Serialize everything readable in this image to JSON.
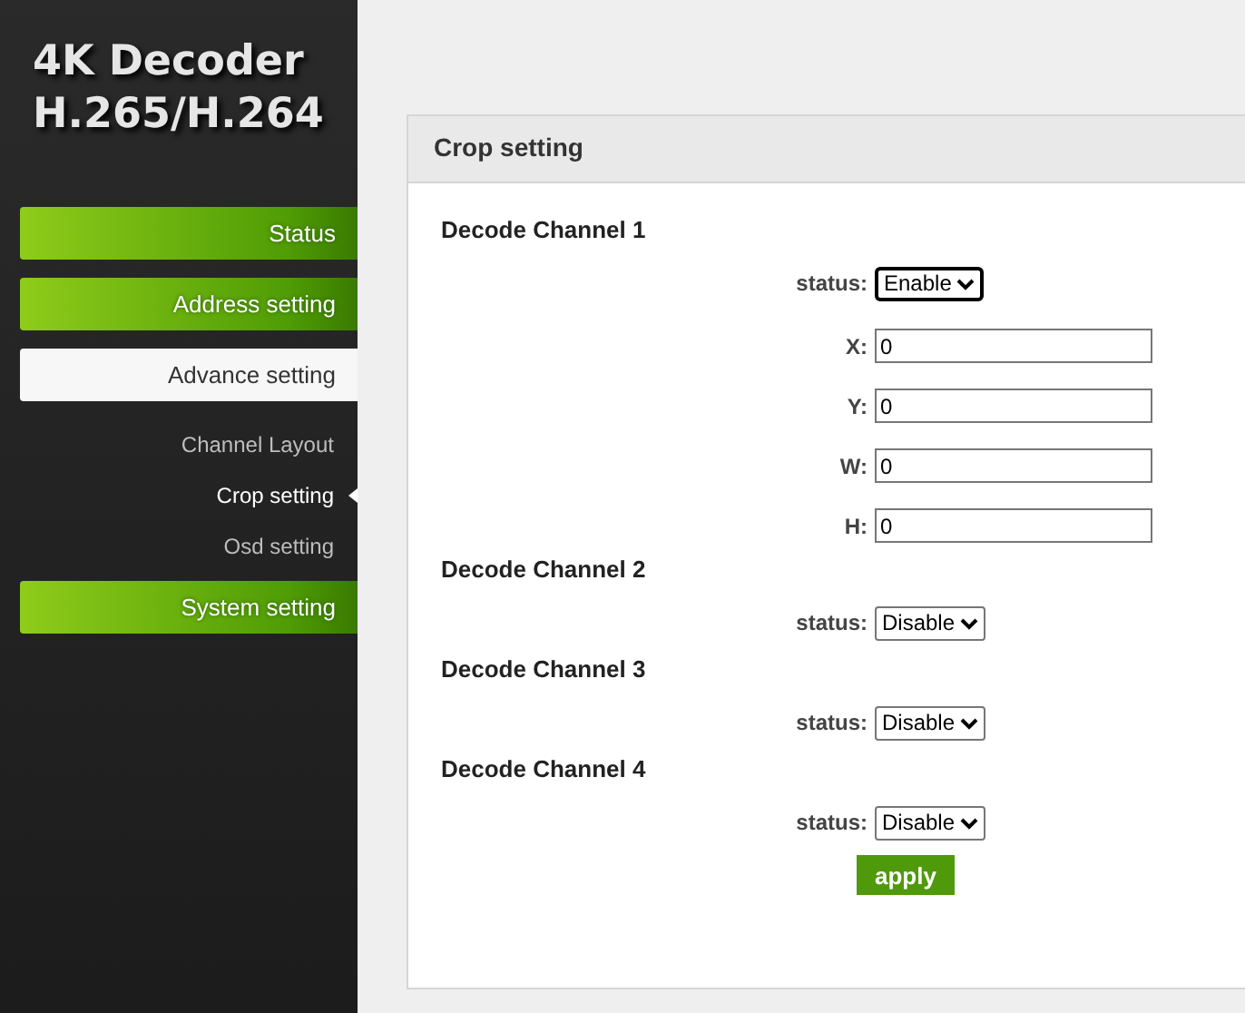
{
  "brand": {
    "line1": "4K Decoder",
    "line2": "H.265/H.264"
  },
  "nav": [
    {
      "label": "Status",
      "selected": false
    },
    {
      "label": "Address setting",
      "selected": false
    },
    {
      "label": "Advance setting",
      "selected": true,
      "children": [
        {
          "label": "Channel Layout",
          "selected": false
        },
        {
          "label": "Crop setting",
          "selected": true
        },
        {
          "label": "Osd setting",
          "selected": false
        }
      ]
    },
    {
      "label": "System setting",
      "selected": false
    }
  ],
  "panel": {
    "title": "Crop setting",
    "channels": [
      {
        "title": "Decode Channel 1",
        "status_label": "status:",
        "status": "Enable",
        "focused": true,
        "fields": [
          {
            "label": "X:",
            "value": "0"
          },
          {
            "label": "Y:",
            "value": "0"
          },
          {
            "label": "W:",
            "value": "0"
          },
          {
            "label": "H:",
            "value": "0"
          }
        ]
      },
      {
        "title": "Decode Channel 2",
        "status_label": "status:",
        "status": "Disable",
        "focused": false
      },
      {
        "title": "Decode Channel 3",
        "status_label": "status:",
        "status": "Disable",
        "focused": false
      },
      {
        "title": "Decode Channel 4",
        "status_label": "status:",
        "status": "Disable",
        "focused": false
      }
    ],
    "apply": "apply"
  }
}
